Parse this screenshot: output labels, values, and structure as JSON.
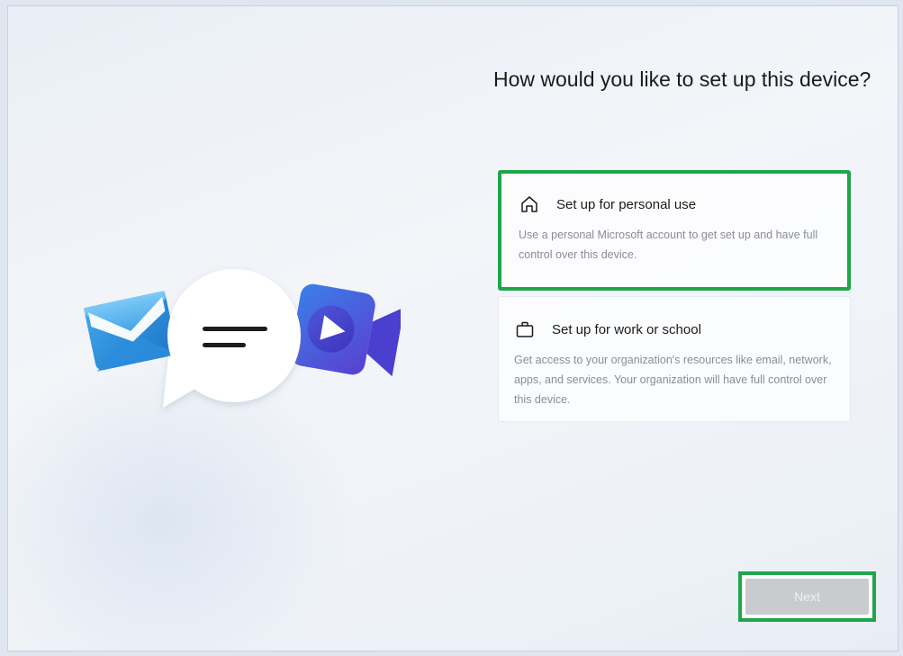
{
  "page": {
    "title": "How would you like to set up this device?"
  },
  "options": [
    {
      "title": "Set up for personal use",
      "description": "Use a personal Microsoft account to get set up and have full control over this device.",
      "icon": "home-icon",
      "selected": true
    },
    {
      "title": "Set up for work or school",
      "description": "Get access to your organization's resources like email, network, apps, and services. Your organization will have full control over this device.",
      "icon": "briefcase-icon",
      "selected": false
    }
  ],
  "footer": {
    "next_label": "Next",
    "next_enabled": false
  },
  "illustration": {
    "icons": [
      "mail-icon",
      "chat-bubble-icon",
      "video-camera-icon"
    ]
  },
  "colors": {
    "highlight": "#1fa64a",
    "text": "#1b1b1b",
    "muted": "#8a8d92",
    "disabled_button": "#c9cbcf"
  }
}
